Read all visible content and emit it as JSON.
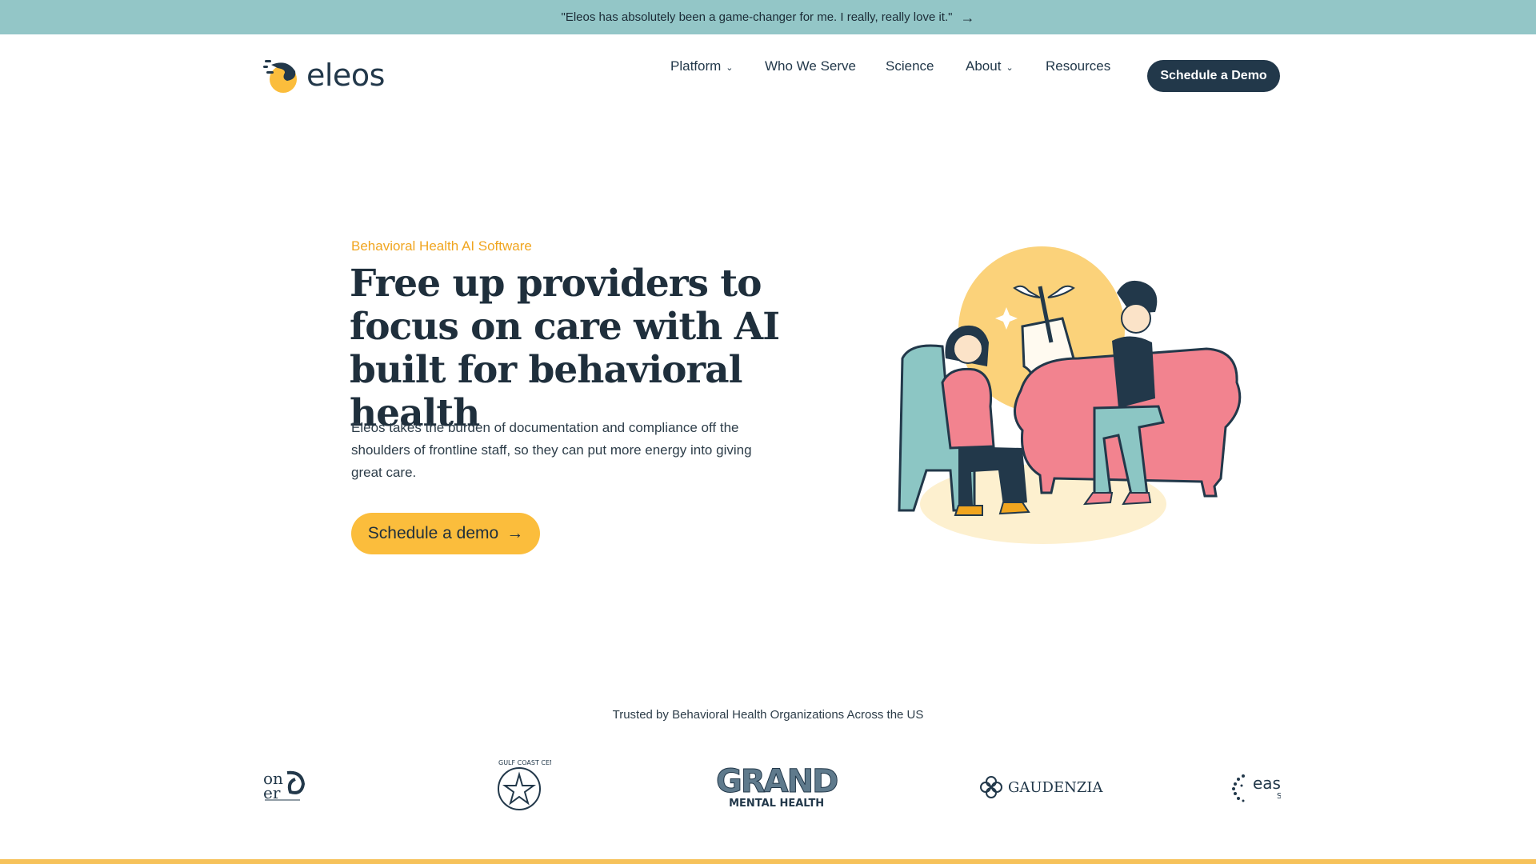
{
  "announcement": {
    "text": "\"Eleos has absolutely been a game-changer for me. I really, really love it.\"",
    "arrow": "→"
  },
  "header": {
    "logo_text": "eleos",
    "nav": {
      "platform": "Platform",
      "who_we_serve": "Who We Serve",
      "science": "Science",
      "about": "About",
      "resources": "Resources"
    },
    "cta_label": "Schedule a Demo"
  },
  "hero": {
    "eyebrow": "Behavioral Health AI Software",
    "title": "Free up providers to focus on care with AI built for behavioral health",
    "description": "Eleos takes the burden of documentation and compliance off the shoulders of frontline staff, so they can put more energy into giving great care.",
    "cta_label": "Schedule a demo",
    "cta_arrow": "→"
  },
  "trusted": {
    "heading": "Trusted by Behavioral Health Organizations Across the US",
    "logos": [
      {
        "name": "partial-logo-left",
        "text": "on er"
      },
      {
        "name": "gulf-coast-center",
        "text": "GULF COAST CENTER"
      },
      {
        "name": "grand-mental-health",
        "text": "GRAND",
        "subtext": "MENTAL HEALTH"
      },
      {
        "name": "gaudenzia",
        "text": "GAUDENZIA"
      },
      {
        "name": "easter-seals",
        "text": "easter",
        "subtext": "Serv"
      }
    ]
  },
  "colors": {
    "announce_bg": "#93c6c7",
    "navy": "#22384a",
    "accent_yellow": "#fbbd3c",
    "eyebrow_orange": "#f0a51f",
    "pink": "#f2838f",
    "teal_chair": "#8cc6c4"
  }
}
